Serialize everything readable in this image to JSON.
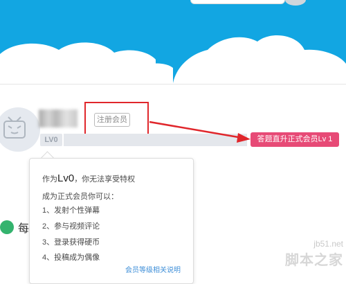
{
  "user": {
    "register_badge": "注册会员",
    "level": "LV0"
  },
  "callout": {
    "upgrade_text": "答题直升正式会员Lv 1"
  },
  "tooltip": {
    "line1_prefix": "作为",
    "line1_level": "Lv0",
    "line1_suffix": "，你无法享受特权",
    "line2": "成为正式会员你可以：",
    "items": [
      "1、发射个性弹幕",
      "2、参与视频评论",
      "3、登录获得硬币",
      "4、投稿成为偶像"
    ],
    "link": "会员等级相关说明"
  },
  "section": {
    "title_partial": "每"
  },
  "watermark": {
    "url": "jb51.net",
    "name": "脚本之家"
  },
  "colors": {
    "banner": "#12a6e2",
    "highlight": "#e0262b",
    "upgrade_tag": "#e74a76",
    "link": "#3f8fd8"
  }
}
